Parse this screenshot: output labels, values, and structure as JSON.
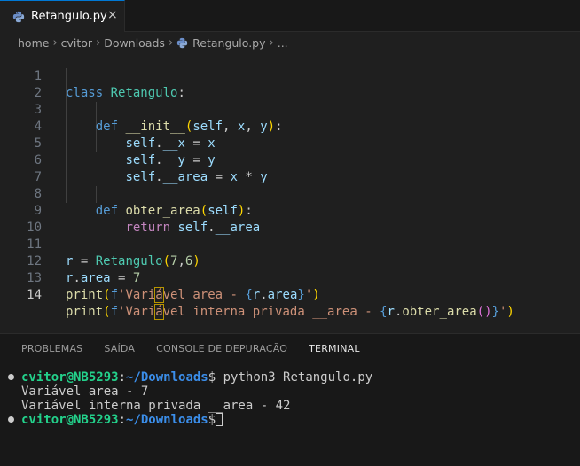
{
  "tab": {
    "label": "Retangulo.py",
    "close": "×"
  },
  "breadcrumb": [
    "home",
    "cvitor",
    "Downloads",
    "Retangulo.py",
    "..."
  ],
  "code": {
    "line_numbers": [
      "1",
      "2",
      "3",
      "4",
      "5",
      "6",
      "7",
      "8",
      "9",
      "10",
      "11",
      "12",
      "13",
      "14"
    ],
    "active_line": "14"
  },
  "panel": {
    "tabs": [
      "PROBLEMAS",
      "SAÍDA",
      "CONSOLE DE DEPURAÇÃO",
      "TERMINAL"
    ],
    "active_tab": "TERMINAL"
  },
  "terminal": {
    "user": "cvitor@NB5293",
    "colon": ":",
    "path": "~/Downloads",
    "dollar": "$",
    "command": " python3 Retangulo.py",
    "output1": "Variável area - 7",
    "output2": "Variável interna privada __area - 42"
  },
  "colors": {
    "accent": "#0078d4",
    "keyword": "#569cd6",
    "class": "#4ec9b0",
    "function": "#dcdcaa",
    "variable": "#9cdcfe",
    "string": "#ce9178",
    "number": "#b5cea8",
    "terminal_user": "#23d18b",
    "terminal_path": "#3b8eea"
  },
  "icons": {
    "tab_icon": "python-icon",
    "close": "close-icon",
    "breadcrumb_file": "python-icon",
    "chevron": "chevron-right-icon"
  }
}
